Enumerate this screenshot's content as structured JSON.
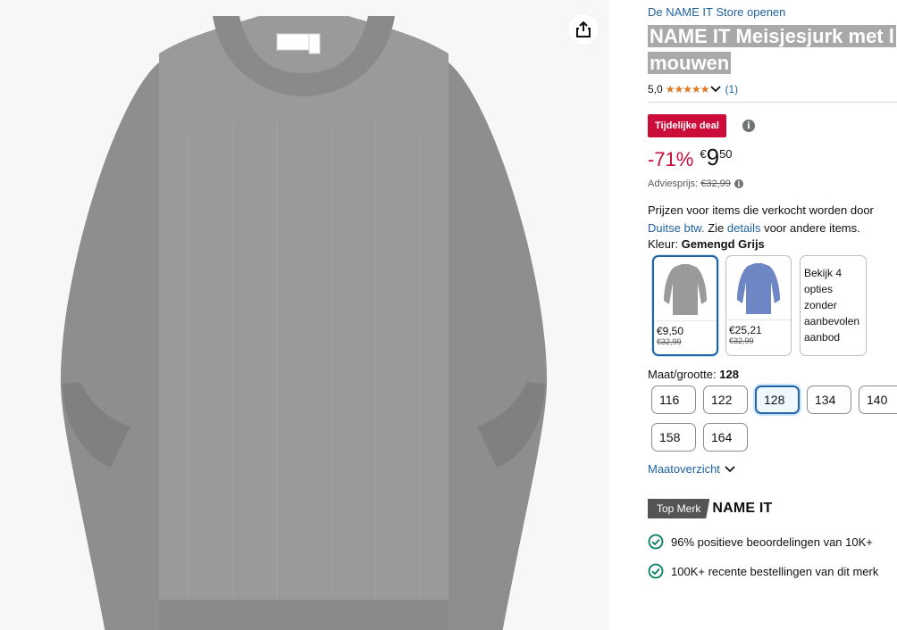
{
  "store": {
    "link": "De NAME IT Store openen"
  },
  "product": {
    "title_line1": "NAME IT Meisjesjurk met l",
    "title_line2": "mouwen"
  },
  "rating": {
    "score": "5,0",
    "stars": "★★★★★",
    "count": "(1)"
  },
  "deal": {
    "badge": "Tijdelijke deal",
    "info_icon": "info-icon"
  },
  "price": {
    "discount": "-71%",
    "currency": "€",
    "whole": "9",
    "fraction": "50",
    "list_label": "Adviesprijs:",
    "list_value": "€32,99"
  },
  "vat": {
    "line1": "Prijzen voor items die verkocht worden door",
    "line2_link": "Duitse btw.",
    "line2_mid": " Zie ",
    "line2_link2": "details",
    "line2_end": " voor andere items."
  },
  "color": {
    "label": "Kleur:",
    "value": "Gemengd Grijs",
    "options": [
      {
        "price": "€9,50",
        "old": "€32,99",
        "tone": "#9a9a9a"
      },
      {
        "price": "€25,21",
        "old": "€32,99",
        "tone": "#6f86c4"
      }
    ],
    "more_text": "Bekijk 4 opties zonder aanbevolen aanbod"
  },
  "size": {
    "label": "Maat/grootte:",
    "value": "128",
    "options": [
      "116",
      "122",
      "128",
      "134",
      "140",
      "158",
      "164"
    ],
    "chart_link": "Maatoverzicht"
  },
  "brand": {
    "badge": "Top Merk",
    "name": "NAME IT"
  },
  "highlights": [
    "96% positieve beoordelingen van 10K+",
    "100K+ recente bestellingen van dit merk"
  ],
  "colors": {
    "accent": "#2162a1",
    "deal": "#cc0c39",
    "star": "#de7921",
    "check": "#067d62"
  }
}
